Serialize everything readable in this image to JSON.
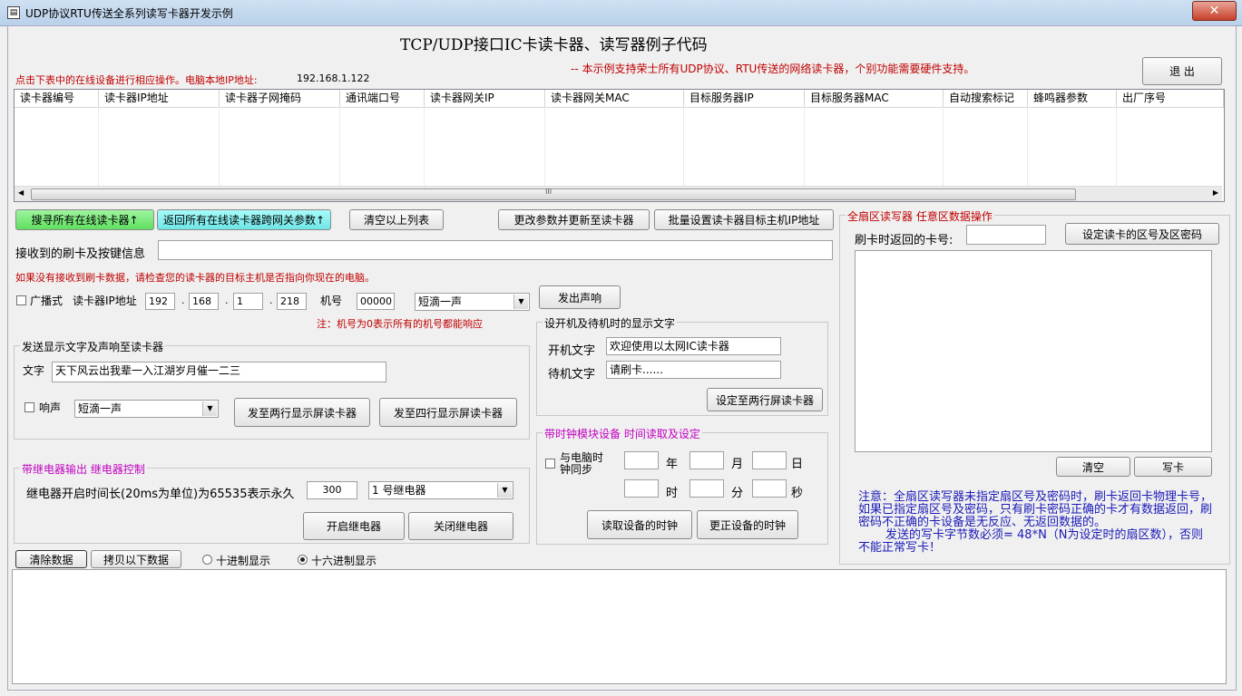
{
  "window": {
    "title": "UDP协议RTU传送全系列读写卡器开发示例",
    "close_glyph": "✕",
    "app_icon": "app-icon"
  },
  "header": {
    "title": "TCP/UDP接口IC卡读卡器、读写器例子代码",
    "hint_left": "点击下表中的在线设备进行相应操作。电脑本地IP地址:",
    "local_ip": "192.168.1.122",
    "hint_right": "-- 本示例支持荣士所有UDP协议、RTU传送的网络读卡器，个别功能需要硬件支持。",
    "exit_label": "退 出"
  },
  "table": {
    "columns": [
      "读卡器编号",
      "读卡器IP地址",
      "读卡器子网掩码",
      "通讯端口号",
      "读卡器网关IP",
      "读卡器网关MAC",
      "目标服务器IP",
      "目标服务器MAC",
      "自动搜索标记",
      "蜂鸣器参数",
      "出厂序号"
    ],
    "rows": [],
    "scroll_glyph": "III"
  },
  "toolbar": {
    "search_label": "搜寻所有在线读卡器↑",
    "return_label": "返回所有在线读卡器跨网关参数↑",
    "clear_list_label": "清空以上列表",
    "update_params_label": "更改参数并更新至读卡器",
    "batch_set_label": "批量设置读卡器目标主机IP地址"
  },
  "receive": {
    "label": "接收到的刷卡及按键信息",
    "value": "",
    "warning": "如果没有接收到刷卡数据，请检查您的读卡器的目标主机是否指向你现在的电脑。"
  },
  "device": {
    "broadcast_label": "广播式",
    "ip_label": "读卡器IP地址",
    "ip": [
      "192",
      "168",
      "1",
      "218"
    ],
    "ip_sep": ".",
    "machine_label": "机号",
    "machine_value": "00000",
    "beep_select": "短滴一声",
    "beep_button": "发出声响",
    "note": "注：机号为0表示所有的机号都能响应"
  },
  "display_group": {
    "title": "发送显示文字及声响至读卡器",
    "text_label": "文字",
    "text_value": "天下风云出我辈一入江湖岁月催一二三",
    "sound_label": "响声",
    "sound_select": "短滴一声",
    "two_line_button": "发至两行显示屏读卡器",
    "four_line_button": "发至四行显示屏读卡器"
  },
  "relay_group": {
    "title": "带继电器输出 继电器控制",
    "duration_label": "继电器开启时间长(20ms为单位)为65535表示永久",
    "duration_value": "300",
    "relay_select": "1 号继电器",
    "open_button": "开启继电器",
    "close_button": "关闭继电器"
  },
  "boot_group": {
    "title": "设开机及待机时的显示文字",
    "boot_label": "开机文字",
    "boot_value": "欢迎使用以太网IC读卡器",
    "standby_label": "待机文字",
    "standby_value": "请刷卡......",
    "set_button": "设定至两行屏读卡器"
  },
  "clock_group": {
    "title": "带时钟模块设备 时间读取及设定",
    "sync_label": "与电脑时钟同步",
    "units": [
      "年",
      "月",
      "日",
      "时",
      "分",
      "秒"
    ],
    "values": [
      "",
      "",
      "",
      "",
      "",
      ""
    ],
    "read_button": "读取设备的时钟",
    "set_button": "更正设备的时钟"
  },
  "sector_group": {
    "title": "全扇区读写器 任意区数据操作",
    "card_label": "刷卡时返回的卡号:",
    "card_value": "",
    "set_key_button": "设定读卡的区号及区密码",
    "data": "",
    "clear_button": "清空",
    "write_button": "写卡",
    "note": "注意：全扇区读写器未指定扇区号及密码时，刷卡返回卡物理卡号，如果已指定扇区号及密码，只有刷卡密码正确的卡才有数据返回，刷密码不正确的卡设备是无反应、无返回数据的。",
    "note2": "发送的写卡字节数必须= 48*N（N为设定时的扇区数），否则不能正常写卡！"
  },
  "log": {
    "clear_button": "清除数据",
    "copy_button": "拷贝以下数据",
    "decimal_label": "十进制显示",
    "hex_label": "十六进制显示",
    "selected": "hex",
    "content": ""
  }
}
